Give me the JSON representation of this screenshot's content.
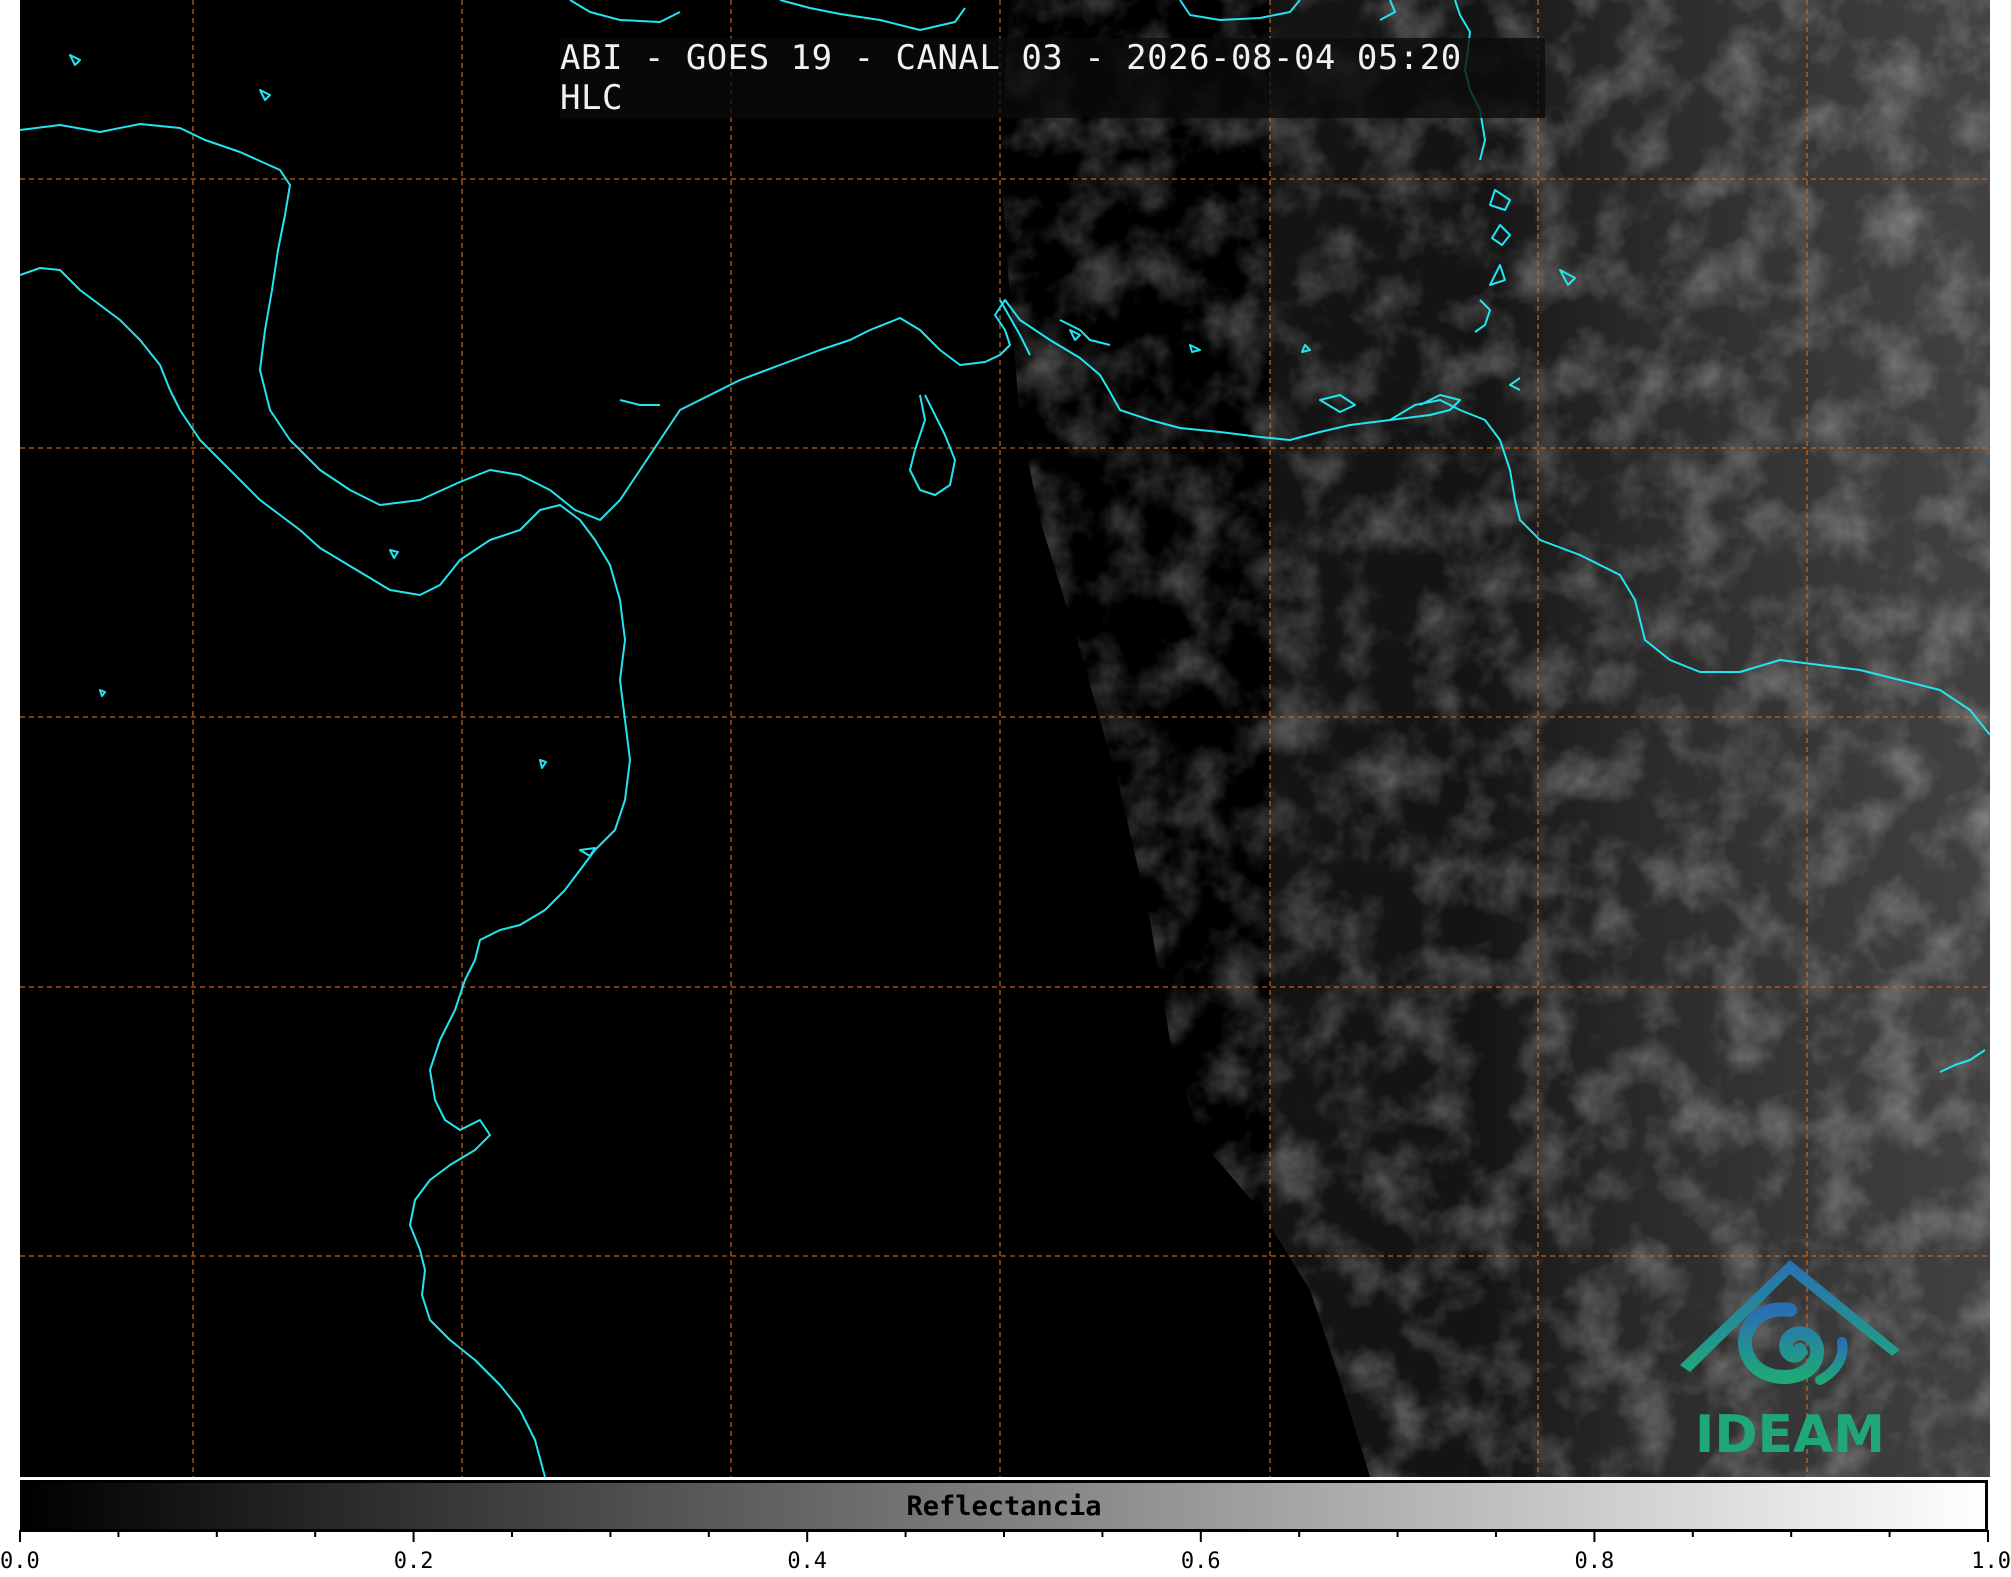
{
  "title": "ABI - GOES 19 - CANAL 03 - 2026-08-04 05:20 HLC",
  "colorbar": {
    "label": "Reflectancia",
    "ticks": [
      "0.0",
      "0.2",
      "0.4",
      "0.6",
      "0.8",
      "1.0"
    ],
    "range": [
      0.0,
      1.0
    ]
  },
  "logo": {
    "text": "IDEAM"
  },
  "colors": {
    "coastline": "#22e5f0",
    "gridline": "#d2691e",
    "logo_blue": "#2a6fb5",
    "logo_green": "#1fa77a"
  }
}
